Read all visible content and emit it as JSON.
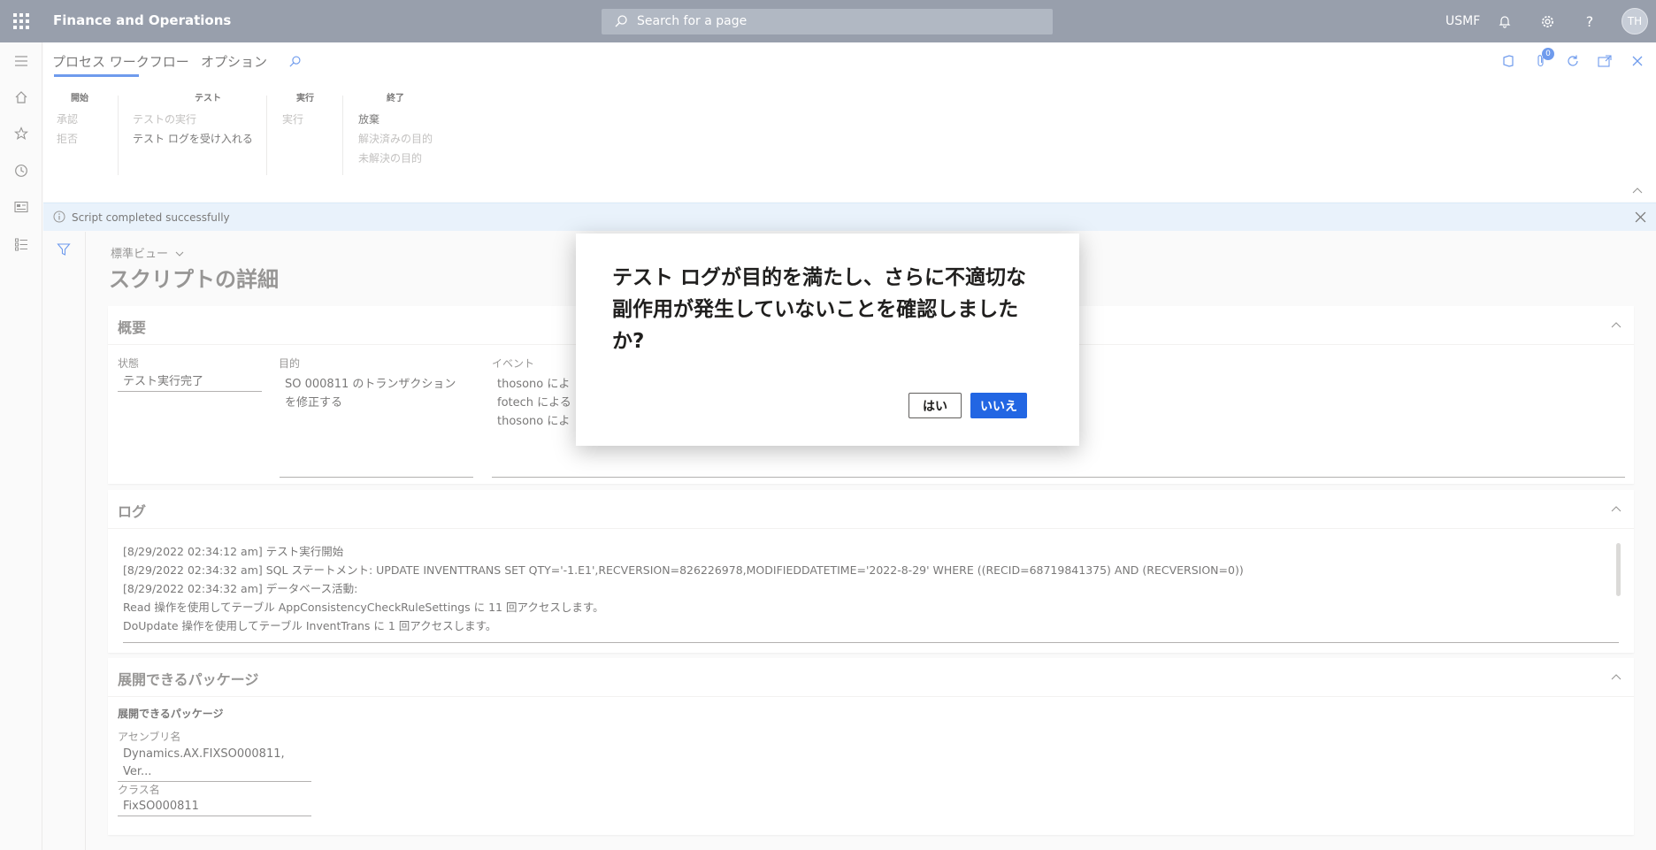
{
  "topbar": {
    "app_title": "Finance and Operations",
    "search_placeholder": "Search for a page",
    "company": "USMF",
    "avatar_initials": "TH"
  },
  "action_pane": {
    "tabs": [
      "プロセス ワークフロー",
      "オプション"
    ],
    "groups": [
      {
        "title": "開始",
        "items": [
          "承認",
          "拒否"
        ]
      },
      {
        "title": "テスト",
        "items": [
          "テストの実行",
          "テスト ログを受け入れる"
        ]
      },
      {
        "title": "実行",
        "items": [
          "実行"
        ]
      },
      {
        "title": "終了",
        "items": [
          "放棄",
          "解決済みの目的",
          "未解決の目的"
        ]
      }
    ],
    "badge_count": "0"
  },
  "infobar": {
    "message": "Script completed successfully"
  },
  "page": {
    "view_name": "標準ビュー",
    "title": "スクリプトの詳細"
  },
  "overview": {
    "header": "概要",
    "status_label": "状態",
    "status_value": "テスト実行完了",
    "purpose_label": "目的",
    "purpose_value": "SO 000811 のトランザクション\nを修正する",
    "event_label": "イベント",
    "event_lines": [
      "thosono によ",
      "fotech による",
      "thosono によ"
    ]
  },
  "log": {
    "header": "ログ",
    "lines": [
      "[8/29/2022 02:34:12 am] テスト実行開始",
      "[8/29/2022 02:34:32 am] SQL ステートメント: UPDATE INVENTTRANS SET QTY='-1.E1',RECVERSION=826226978,MODIFIEDDATETIME='2022-8-29' WHERE ((RECID=68719841375) AND (RECVERSION=0))",
      "[8/29/2022 02:34:32 am] データベース活動:",
      "Read 操作を使用してテーブル AppConsistencyCheckRuleSettings に 11 回アクセスします。",
      "DoUpdate 操作を使用してテーブル InventTrans に 1 回アクセスします。"
    ]
  },
  "packages": {
    "header": "展開できるパッケージ",
    "subheader": "展開できるパッケージ",
    "assembly_label": "アセンブリ名",
    "assembly_value": "Dynamics.AX.FIXSO000811, Ver...",
    "class_label": "クラス名",
    "class_value": "FixSO000811"
  },
  "dialog": {
    "message": "テスト ログが目的を満たし、さらに不適切な副作用が発生していないことを確認しましたか?",
    "yes_label": "はい",
    "no_label": "いいえ"
  },
  "colors": {
    "topbar": "#616c80",
    "accent": "#2266e3",
    "infobar": "#deecf9"
  }
}
